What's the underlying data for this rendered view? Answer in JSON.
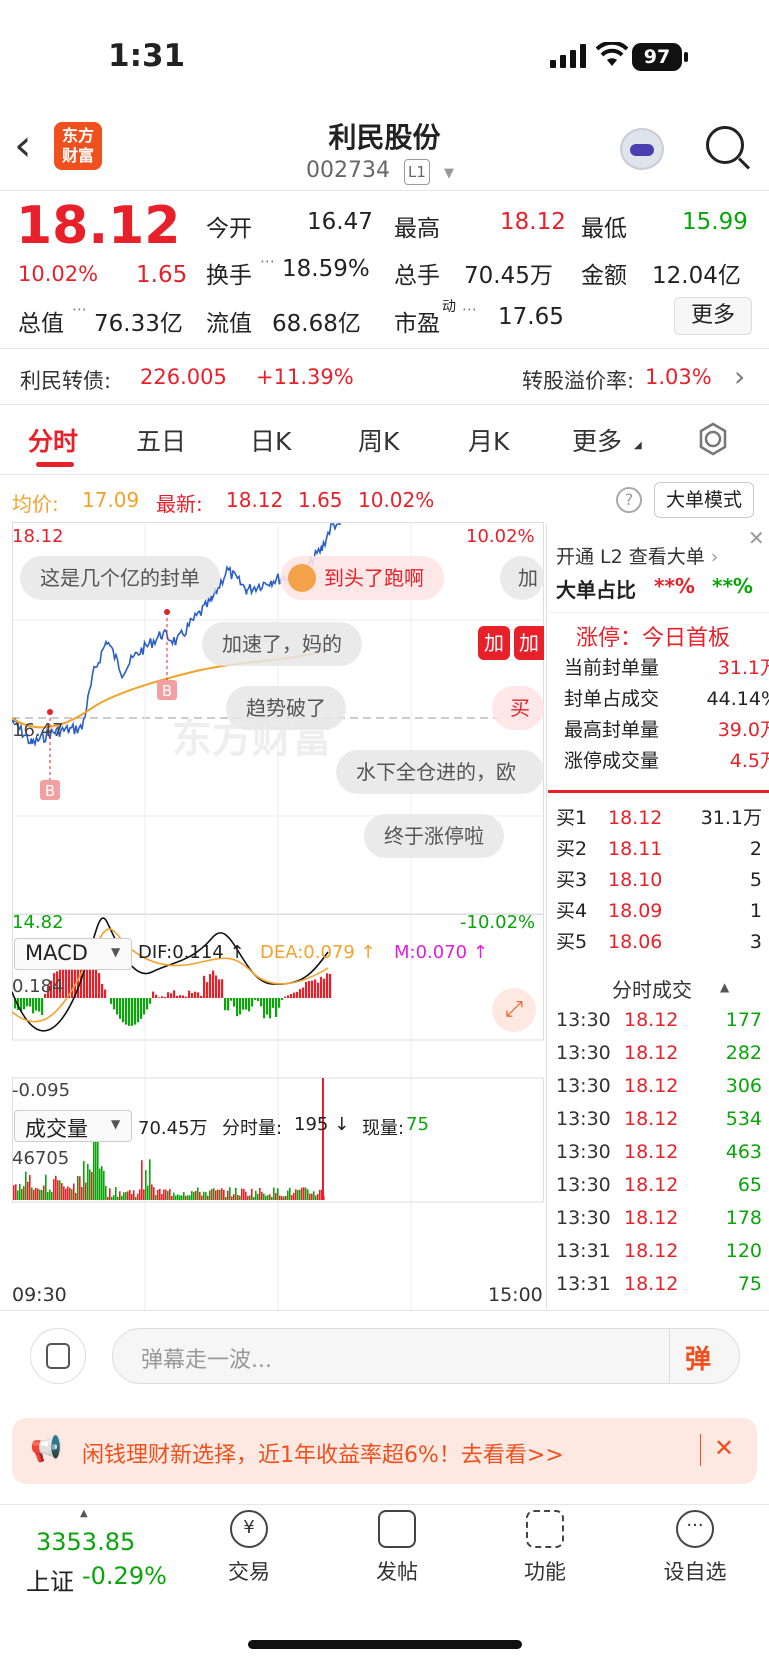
{
  "status_bar": {
    "time": "1:31",
    "battery": "97"
  },
  "header": {
    "logo_line1": "东方",
    "logo_line2": "财富",
    "title": "利民股份",
    "code": "002734",
    "level": "L1"
  },
  "quote": {
    "price": "18.12",
    "change_pct": "10.02%",
    "change": "1.65",
    "open_label": "今开",
    "open": "16.47",
    "high_label": "最高",
    "high": "18.12",
    "low_label": "最低",
    "low": "15.99",
    "turnover_label": "换手",
    "turnover": "18.59%",
    "volume_label": "总手",
    "volume": "70.45万",
    "amount_label": "金额",
    "amount": "12.04亿",
    "mktcap_label": "总值",
    "mktcap": "76.33亿",
    "float_label": "流值",
    "float": "68.68亿",
    "pe_label": "市盈",
    "pe_sup": "动",
    "pe": "17.65",
    "more": "更多"
  },
  "bond": {
    "label": "利民转债:",
    "price": "226.005",
    "change": "+11.39%",
    "premium_label": "转股溢价率:",
    "premium": "1.03%"
  },
  "tabs": [
    "分时",
    "五日",
    "日K",
    "周K",
    "月K",
    "更多"
  ],
  "chart": {
    "avg_label": "均价:",
    "avg": "17.09",
    "last_label": "最新:",
    "last": "18.12",
    "chg": "1.65",
    "pct": "10.02%",
    "big_order": "大单模式",
    "y_top": "18.12",
    "y_mid": "16.47",
    "y_bot": "14.82",
    "pct_top": "10.02%",
    "pct_bot": "-10.02%",
    "marker": "B",
    "watermark": "东方财富",
    "macd_label": "MACD",
    "dif": "DIF:0.114 ↑",
    "dea": "DEA:0.079 ↑",
    "m": "M:0.070 ↑",
    "macd_top": "0.184",
    "macd_bot": "-0.095",
    "vol_label": "成交量",
    "vol_total": "70.45万",
    "vol_time_label": "分时量:",
    "vol_time": "195 ↓",
    "vol_now_label": "现量:",
    "vol_now": "75",
    "vol_max": "46705",
    "t_start": "09:30",
    "t_end": "15:00"
  },
  "danmaku": [
    "这是几个亿的封单",
    "到头了跑啊",
    "加",
    "加速了，妈的",
    "加",
    "加",
    "趋势破了",
    "买",
    "水下全仓进的，欧",
    "终于涨停啦"
  ],
  "panel": {
    "l2": "开通 L2 查看大单",
    "big_ratio_label": "大单占比",
    "big_r1": "**%",
    "big_r2": "**%",
    "limit": "涨停：今日首板",
    "rows": [
      {
        "label": "当前封单量",
        "value": "31.1万"
      },
      {
        "label": "封单占成交",
        "value": "44.14%"
      },
      {
        "label": "最高封单量",
        "value": "39.0万"
      },
      {
        "label": "涨停成交量",
        "value": "4.5万"
      }
    ],
    "bids": [
      {
        "label": "买1",
        "price": "18.12",
        "vol": "31.1万"
      },
      {
        "label": "买2",
        "price": "18.11",
        "vol": "2"
      },
      {
        "label": "买3",
        "price": "18.10",
        "vol": "5"
      },
      {
        "label": "买4",
        "price": "18.09",
        "vol": "1"
      },
      {
        "label": "买5",
        "price": "18.06",
        "vol": "3"
      }
    ],
    "ticks_title": "分时成交",
    "ticks": [
      {
        "t": "13:30",
        "p": "18.12",
        "v": "177"
      },
      {
        "t": "13:30",
        "p": "18.12",
        "v": "282"
      },
      {
        "t": "13:30",
        "p": "18.12",
        "v": "306"
      },
      {
        "t": "13:30",
        "p": "18.12",
        "v": "534"
      },
      {
        "t": "13:30",
        "p": "18.12",
        "v": "463"
      },
      {
        "t": "13:30",
        "p": "18.12",
        "v": "65"
      },
      {
        "t": "13:30",
        "p": "18.12",
        "v": "178"
      },
      {
        "t": "13:31",
        "p": "18.12",
        "v": "120"
      },
      {
        "t": "13:31",
        "p": "18.12",
        "v": "75"
      }
    ]
  },
  "comment": {
    "placeholder": "弹幕走一波...",
    "send": "弹"
  },
  "ad": {
    "text": "闲钱理财新选择，近1年收益率超6%！去看看>>"
  },
  "bottom_nav": {
    "index_value": "3353.85",
    "index_name": "上证",
    "index_pct": "-0.29%",
    "items": [
      "交易",
      "发帖",
      "功能",
      "设自选"
    ]
  }
}
